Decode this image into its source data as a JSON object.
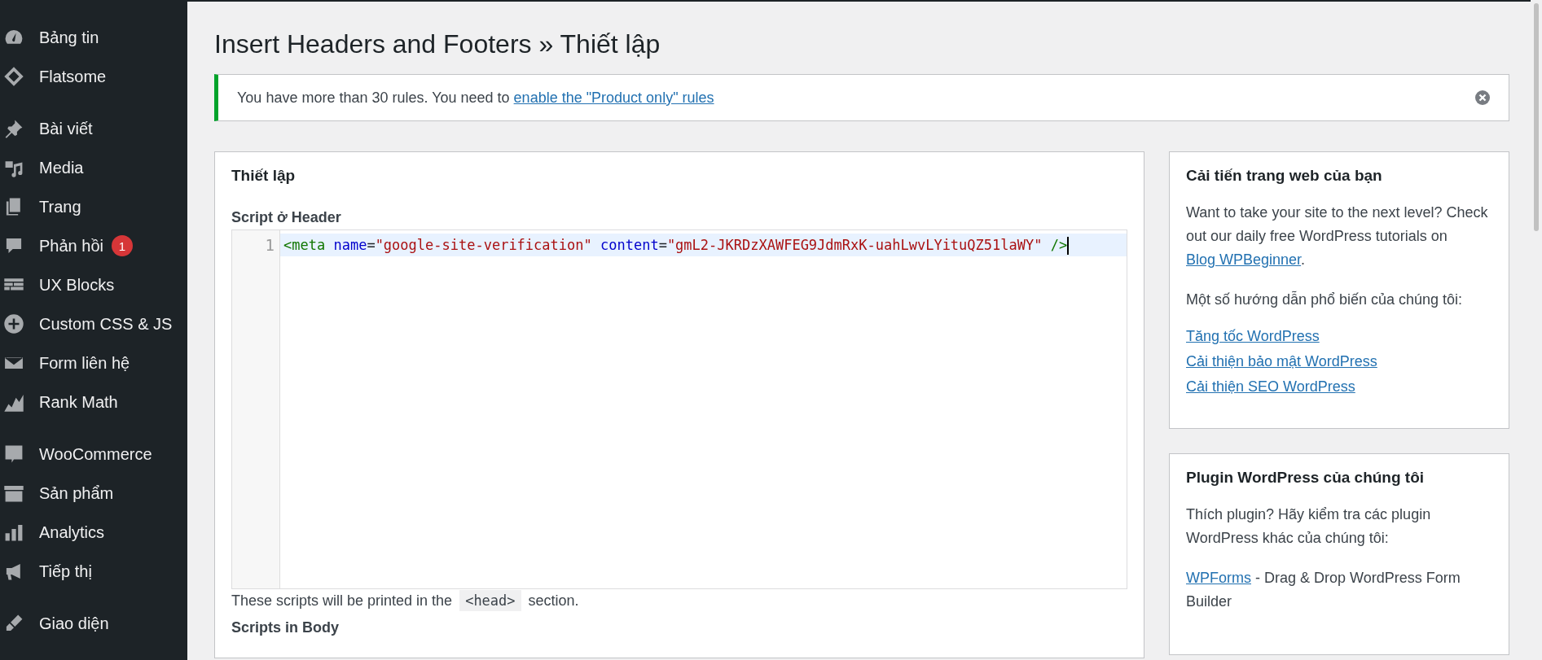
{
  "sidebar": {
    "groups": [
      {
        "items": [
          {
            "label": "Bảng tin"
          },
          {
            "label": "Flatsome"
          }
        ]
      },
      {
        "items": [
          {
            "label": "Bài viết"
          },
          {
            "label": "Media"
          },
          {
            "label": "Trang"
          },
          {
            "label": "Phản hồi",
            "badge": "1"
          },
          {
            "label": "UX Blocks"
          },
          {
            "label": "Custom CSS & JS"
          },
          {
            "label": "Form liên hệ"
          },
          {
            "label": "Rank Math"
          }
        ]
      },
      {
        "items": [
          {
            "label": "WooCommerce"
          },
          {
            "label": "Sản phẩm"
          },
          {
            "label": "Analytics"
          },
          {
            "label": "Tiếp thị"
          }
        ]
      },
      {
        "items": [
          {
            "label": "Giao diện"
          }
        ]
      }
    ]
  },
  "page_title": "Insert Headers and Footers » Thiết lập",
  "notice": {
    "text": "You have more than 30 rules. You need to ",
    "link": "enable the \"Product only\" rules"
  },
  "settings_panel": {
    "title": "Thiết lập",
    "header_script": {
      "label": "Script ở Header",
      "lines": [
        {
          "number": "1",
          "tokens": [
            {
              "kind": "tag",
              "text": "<meta"
            },
            {
              "kind": "attr",
              "text": " name"
            },
            {
              "kind": "plain",
              "text": "="
            },
            {
              "kind": "string",
              "text": "\"google-site-verification\""
            },
            {
              "kind": "attr",
              "text": " content"
            },
            {
              "kind": "plain",
              "text": "="
            },
            {
              "kind": "string",
              "text": "\"gmL2-JKRDzXAWFEG9JdmRxK-uahLwvLYituQZ51laWY\""
            },
            {
              "kind": "tag",
              "text": " />"
            }
          ]
        }
      ],
      "help_before": "These scripts will be printed in the ",
      "help_code": "<head>",
      "help_after": " section."
    },
    "next_label": "Scripts in Body"
  },
  "improve_panel": {
    "title": "Cải tiến trang web của bạn",
    "intro": "Want to take your site to the next level? Check out our daily free WordPress tutorials on ",
    "intro_link": "Blog WPBeginner",
    "intro_after": ".",
    "guides_label": "Một số hướng dẫn phổ biến của chúng tôi:",
    "links": [
      "Tăng tốc WordPress",
      "Cải thiện bảo mật WordPress",
      "Cải thiện SEO WordPress"
    ]
  },
  "plugins_panel": {
    "title": "Plugin WordPress của chúng tôi",
    "intro": "Thích plugin? Hãy kiểm tra các plugin WordPress khác của chúng tôi:",
    "items": [
      {
        "link": "WPForms",
        "text": " - Drag & Drop WordPress Form Builder"
      }
    ]
  }
}
